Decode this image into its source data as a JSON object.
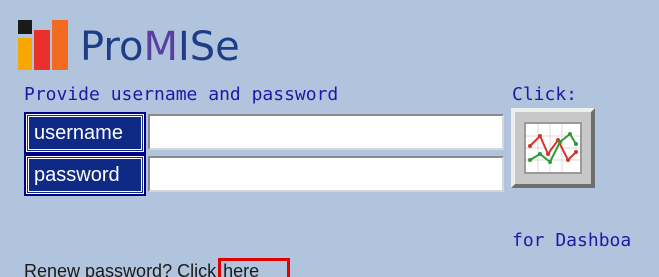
{
  "logo": {
    "icon": "promise-logo-icon",
    "text_pro": "Pro",
    "text_m": "M",
    "text_ise": "ISe",
    "colors": [
      "#1a1a1a",
      "#f7a800",
      "#e8312a",
      "#f36b21"
    ]
  },
  "login": {
    "prompt": "Provide username and password",
    "username_label": "username",
    "username_value": "",
    "username_placeholder": "",
    "password_label": "password",
    "password_value": "",
    "password_placeholder": ""
  },
  "dashboard": {
    "click_label": "Click:",
    "icon": "line-chart-icon",
    "caption": "for Dashboa"
  },
  "renew": {
    "text": "Renew password? Click",
    "link_label": "here"
  },
  "colors": {
    "background": "#b0c4de",
    "label_bg": "#0e2a86",
    "accent_text": "#1a1aa6",
    "highlight": "#e00000"
  }
}
